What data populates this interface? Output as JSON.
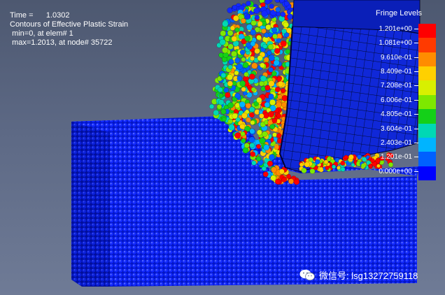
{
  "info": {
    "time_label": "Time =",
    "time_value": "1.0302",
    "contour_title": "Contours of Effective Plastic Strain",
    "min_text": "min=0, at elem# 1",
    "max_text": "max=1.2013, at node# 35722"
  },
  "legend": {
    "title": "Fringe Levels",
    "labels": [
      "1.201e+00",
      "1.081e+00",
      "9.610e-01",
      "8.409e-01",
      "7.208e-01",
      "6.006e-01",
      "4.805e-01",
      "3.604e-01",
      "2.403e-01",
      "1.201e-01",
      "0.000e+00"
    ],
    "colors": [
      "#ff0000",
      "#ff3a00",
      "#ff8c00",
      "#ffd000",
      "#d8f000",
      "#7ee800",
      "#14d018",
      "#00d8b4",
      "#00b4ff",
      "#0060ff",
      "#0000ff"
    ]
  },
  "watermark": {
    "text": "微信号: lsg13272759118",
    "icon": "wechat-icon"
  },
  "scene_colors": {
    "background": "#58647e",
    "particle_low": "#0a1be0",
    "tool_face": "#0f26d6",
    "mesh_line": "#000033"
  }
}
